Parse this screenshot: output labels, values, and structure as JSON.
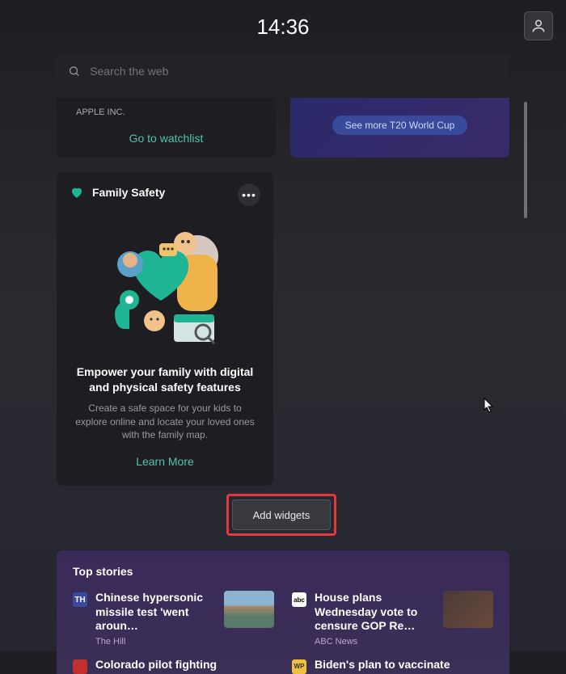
{
  "time": "14:36",
  "search": {
    "placeholder": "Search the web"
  },
  "watchlist": {
    "apple_label": "APPLE INC.",
    "link": "Go to watchlist"
  },
  "sports": {
    "pill": "See more T20 World Cup"
  },
  "family": {
    "title": "Family Safety",
    "heading": "Empower your family with digital and physical safety features",
    "sub": "Create a safe space for your kids to explore online and locate your loved ones with the family map.",
    "learn": "Learn More"
  },
  "add_widgets": "Add widgets",
  "top_stories": {
    "title": "Top stories",
    "items": [
      {
        "title": "Chinese hypersonic missile test 'went aroun…",
        "source": "The Hill"
      },
      {
        "title": "House plans Wednesday vote to censure GOP Re…",
        "source": "ABC News"
      },
      {
        "title": "Colorado pilot fighting",
        "source": ""
      },
      {
        "title": "Biden's plan to vaccinate",
        "source": ""
      }
    ]
  }
}
